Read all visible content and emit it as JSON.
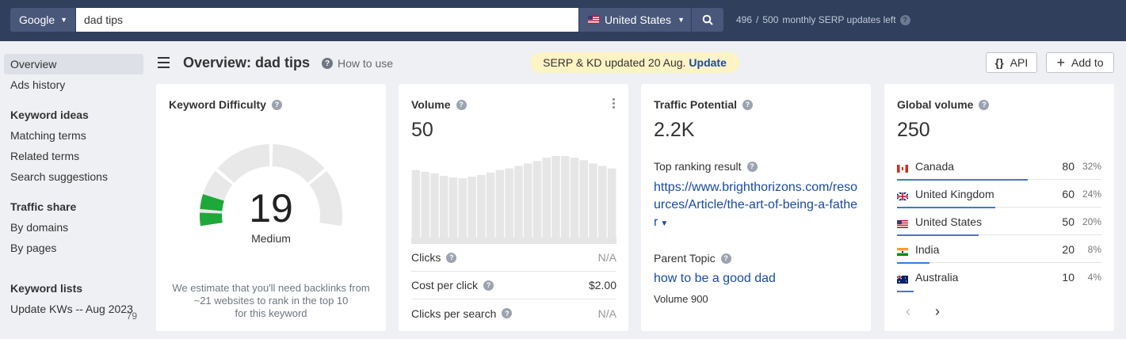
{
  "topbar": {
    "engine": "Google",
    "query": "dad tips",
    "country": "United States",
    "updates_used": "496",
    "updates_sep": "/",
    "updates_total": "500",
    "updates_text": "monthly SERP updates left"
  },
  "sidebar": {
    "items": [
      {
        "label": "Overview",
        "active": true
      },
      {
        "label": "Ads history"
      }
    ],
    "keyword_ideas": {
      "heading": "Keyword ideas",
      "items": [
        "Matching terms",
        "Related terms",
        "Search suggestions"
      ]
    },
    "traffic_share": {
      "heading": "Traffic share",
      "items": [
        "By domains",
        "By pages"
      ]
    },
    "keyword_lists": {
      "heading": "Keyword lists",
      "list_name": "Update KWs -- Aug 2023",
      "count": "79"
    }
  },
  "header": {
    "title": "Overview: dad tips",
    "how_to": "How to use",
    "banner_text": "SERP & KD updated 20 Aug.",
    "banner_link": "Update",
    "api_label": "API",
    "add_label": "Add to"
  },
  "kd": {
    "title": "Keyword Difficulty",
    "value": "19",
    "level": "Medium",
    "score_fraction": 0.19,
    "note_line1": "We estimate that you'll need backlinks from",
    "note_line2": "~21 websites to rank in the top 10",
    "note_line3": "for this keyword"
  },
  "volume": {
    "title": "Volume",
    "value": "50",
    "trend": [
      0.82,
      0.8,
      0.78,
      0.75,
      0.73,
      0.72,
      0.74,
      0.76,
      0.79,
      0.82,
      0.84,
      0.87,
      0.9,
      0.93,
      0.97,
      0.99,
      0.99,
      0.97,
      0.94,
      0.9,
      0.87,
      0.84
    ],
    "clicks_label": "Clicks",
    "clicks_value": "N/A",
    "cpc_label": "Cost per click",
    "cpc_value": "$2.00",
    "cps_label": "Clicks per search",
    "cps_value": "N/A"
  },
  "traffic": {
    "title": "Traffic Potential",
    "value": "2.2K",
    "top_label": "Top ranking result",
    "top_url": "https://www.brighthorizons.com/resources/Article/the-art-of-being-a-father",
    "parent_label": "Parent Topic",
    "parent_topic": "how to be a good dad",
    "parent_volume": "Volume 900"
  },
  "global": {
    "title": "Global volume",
    "value": "250",
    "countries": [
      {
        "name": "Canada",
        "value": "80",
        "pct": "32%",
        "share": 0.32,
        "flag": "ca"
      },
      {
        "name": "United Kingdom",
        "value": "60",
        "pct": "24%",
        "share": 0.24,
        "flag": "gb"
      },
      {
        "name": "United States",
        "value": "50",
        "pct": "20%",
        "share": 0.2,
        "flag": "us"
      },
      {
        "name": "India",
        "value": "20",
        "pct": "8%",
        "share": 0.08,
        "flag": "in"
      },
      {
        "name": "Australia",
        "value": "10",
        "pct": "4%",
        "share": 0.04,
        "flag": "au"
      }
    ]
  },
  "colors": {
    "accent": "#1a4ba8",
    "topbar": "#2f3f5c",
    "kd_green": "#1fa83a",
    "bar_blue": "#3a7bd5"
  }
}
